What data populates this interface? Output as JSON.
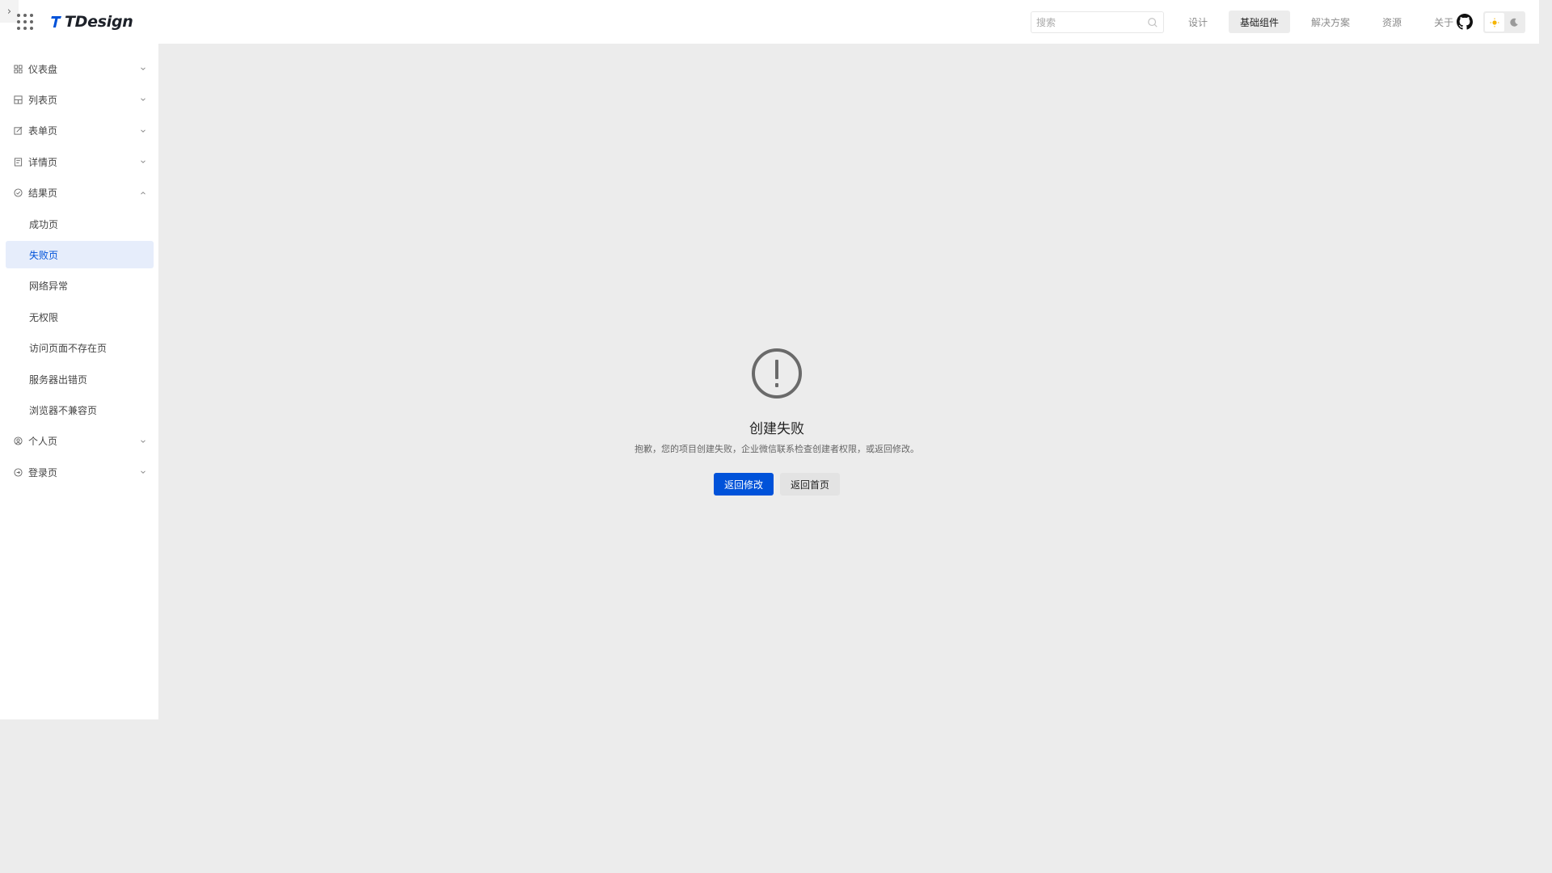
{
  "header": {
    "collapse_glyph": "›",
    "logo_text": "TDesign",
    "search": {
      "placeholder": "搜索",
      "value": ""
    },
    "nav": [
      {
        "label": "设计",
        "active": false
      },
      {
        "label": "基础组件",
        "active": true
      },
      {
        "label": "解决方案",
        "active": false
      },
      {
        "label": "资源",
        "active": false
      },
      {
        "label": "关于",
        "active": false
      }
    ],
    "theme": {
      "current": "light"
    }
  },
  "sidebar": {
    "items": [
      {
        "label": "仪表盘",
        "icon": "dashboard-icon",
        "expanded": false
      },
      {
        "label": "列表页",
        "icon": "list-icon",
        "expanded": false
      },
      {
        "label": "表单页",
        "icon": "edit-icon",
        "expanded": false
      },
      {
        "label": "详情页",
        "icon": "detail-icon",
        "expanded": false
      },
      {
        "label": "结果页",
        "icon": "check-circle-icon",
        "expanded": true,
        "children": [
          {
            "label": "成功页",
            "active": false
          },
          {
            "label": "失败页",
            "active": true
          },
          {
            "label": "网络异常",
            "active": false
          },
          {
            "label": "无权限",
            "active": false
          },
          {
            "label": "访问页面不存在页",
            "active": false
          },
          {
            "label": "服务器出错页",
            "active": false
          },
          {
            "label": "浏览器不兼容页",
            "active": false
          }
        ]
      },
      {
        "label": "个人页",
        "icon": "user-circle-icon",
        "expanded": false
      },
      {
        "label": "登录页",
        "icon": "login-icon",
        "expanded": false
      }
    ]
  },
  "result": {
    "title": "创建失败",
    "description": "抱歉，您的项目创建失败，企业微信联系检查创建者权限，或返回修改。",
    "primary_button": "返回修改",
    "secondary_button": "返回首页",
    "icon": "error-circle-icon"
  },
  "colors": {
    "brand": "#0052d9",
    "active_menu_bg": "#e6edfb",
    "page_bg": "#ececec"
  }
}
